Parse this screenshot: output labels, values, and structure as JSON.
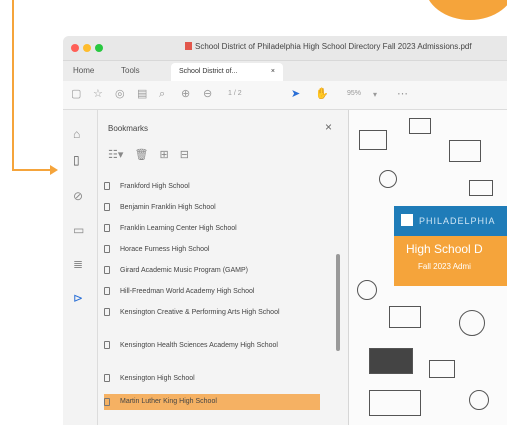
{
  "window": {
    "title": "School District of Philadelphia High School Directory Fall 2023 Admissions.pdf"
  },
  "menu": {
    "home": "Home",
    "tools": "Tools",
    "doc_tab": "School District of...",
    "doc_tab_close": "×"
  },
  "toolbar": {
    "page_indicator": "1 / 2",
    "zoom": "95%"
  },
  "bookmarks_panel": {
    "title": "Bookmarks",
    "close": "×",
    "items": [
      {
        "label": "Frankford High School"
      },
      {
        "label": "Benjamin Franklin High School"
      },
      {
        "label": "Franklin Learning Center High School"
      },
      {
        "label": "Horace Furness High School"
      },
      {
        "label": "Girard Academic Music Program (GAMP)"
      },
      {
        "label": "Hill-Freedman World Academy High School"
      },
      {
        "label": "Kensington Creative & Performing Arts High School"
      },
      {
        "label": "Kensington Health Sciences Academy High School"
      },
      {
        "label": "Kensington High School"
      },
      {
        "label": "Martin Luther King High School",
        "selected": true
      }
    ]
  },
  "document": {
    "brand": "PHILADELPHIA",
    "cover_title": "High School D",
    "cover_subtitle": "Fall 2023 Admi"
  },
  "colors": {
    "accent": "#f5a43b",
    "selection": "#f5b163",
    "brand_blue": "#1f7cb8"
  },
  "icons": {
    "rail": [
      "home-icon",
      "bookmark-icon",
      "attachment-icon",
      "page-icon",
      "layers-icon",
      "tag-icon"
    ]
  }
}
